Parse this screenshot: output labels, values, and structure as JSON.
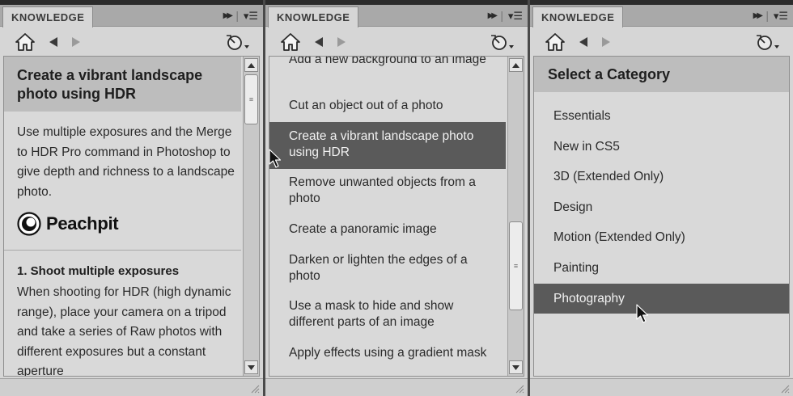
{
  "panels": [
    {
      "tab": "KNOWLEDGE",
      "article": {
        "title": "Create a vibrant landscape photo using HDR",
        "description": "Use multiple exposures and the Merge to HDR Pro command in Photoshop to give depth and richness to a landscape photo.",
        "publisher": "Peachpit",
        "step_title": "1. Shoot multiple exposures",
        "step_body": "When shooting for HDR (high dynamic range), place your camera on a tripod and take a series of Raw photos with different exposures but a constant aperture"
      }
    },
    {
      "tab": "KNOWLEDGE",
      "items": [
        "Add a new background to an image",
        "Cut an object out of a photo",
        "Create a vibrant landscape photo using HDR",
        "Remove unwanted objects from a photo",
        "Create a panoramic image",
        "Darken or lighten the edges of a photo",
        "Use a mask to hide and show different parts of an image",
        "Apply effects using a gradient mask"
      ],
      "selected_index": 2
    },
    {
      "tab": "KNOWLEDGE",
      "header": "Select a Category",
      "categories": [
        "Essentials",
        "New in CS5",
        "3D (Extended Only)",
        "Design",
        "Motion (Extended Only)",
        "Painting",
        "Photography"
      ],
      "selected_index": 6
    }
  ],
  "icons": {
    "home": "home-icon",
    "back": "back-arrow-icon",
    "forward": "forward-arrow-icon",
    "history": "history-clock-icon",
    "tab_expand": "double-arrow-icon",
    "tab_menu": "panel-menu-icon"
  },
  "colors": {
    "panel_bg": "#d6d6d6",
    "header_bg": "#bdbdbd",
    "selection_bg": "#5a5a5a",
    "selection_text": "#f2f2f2"
  }
}
